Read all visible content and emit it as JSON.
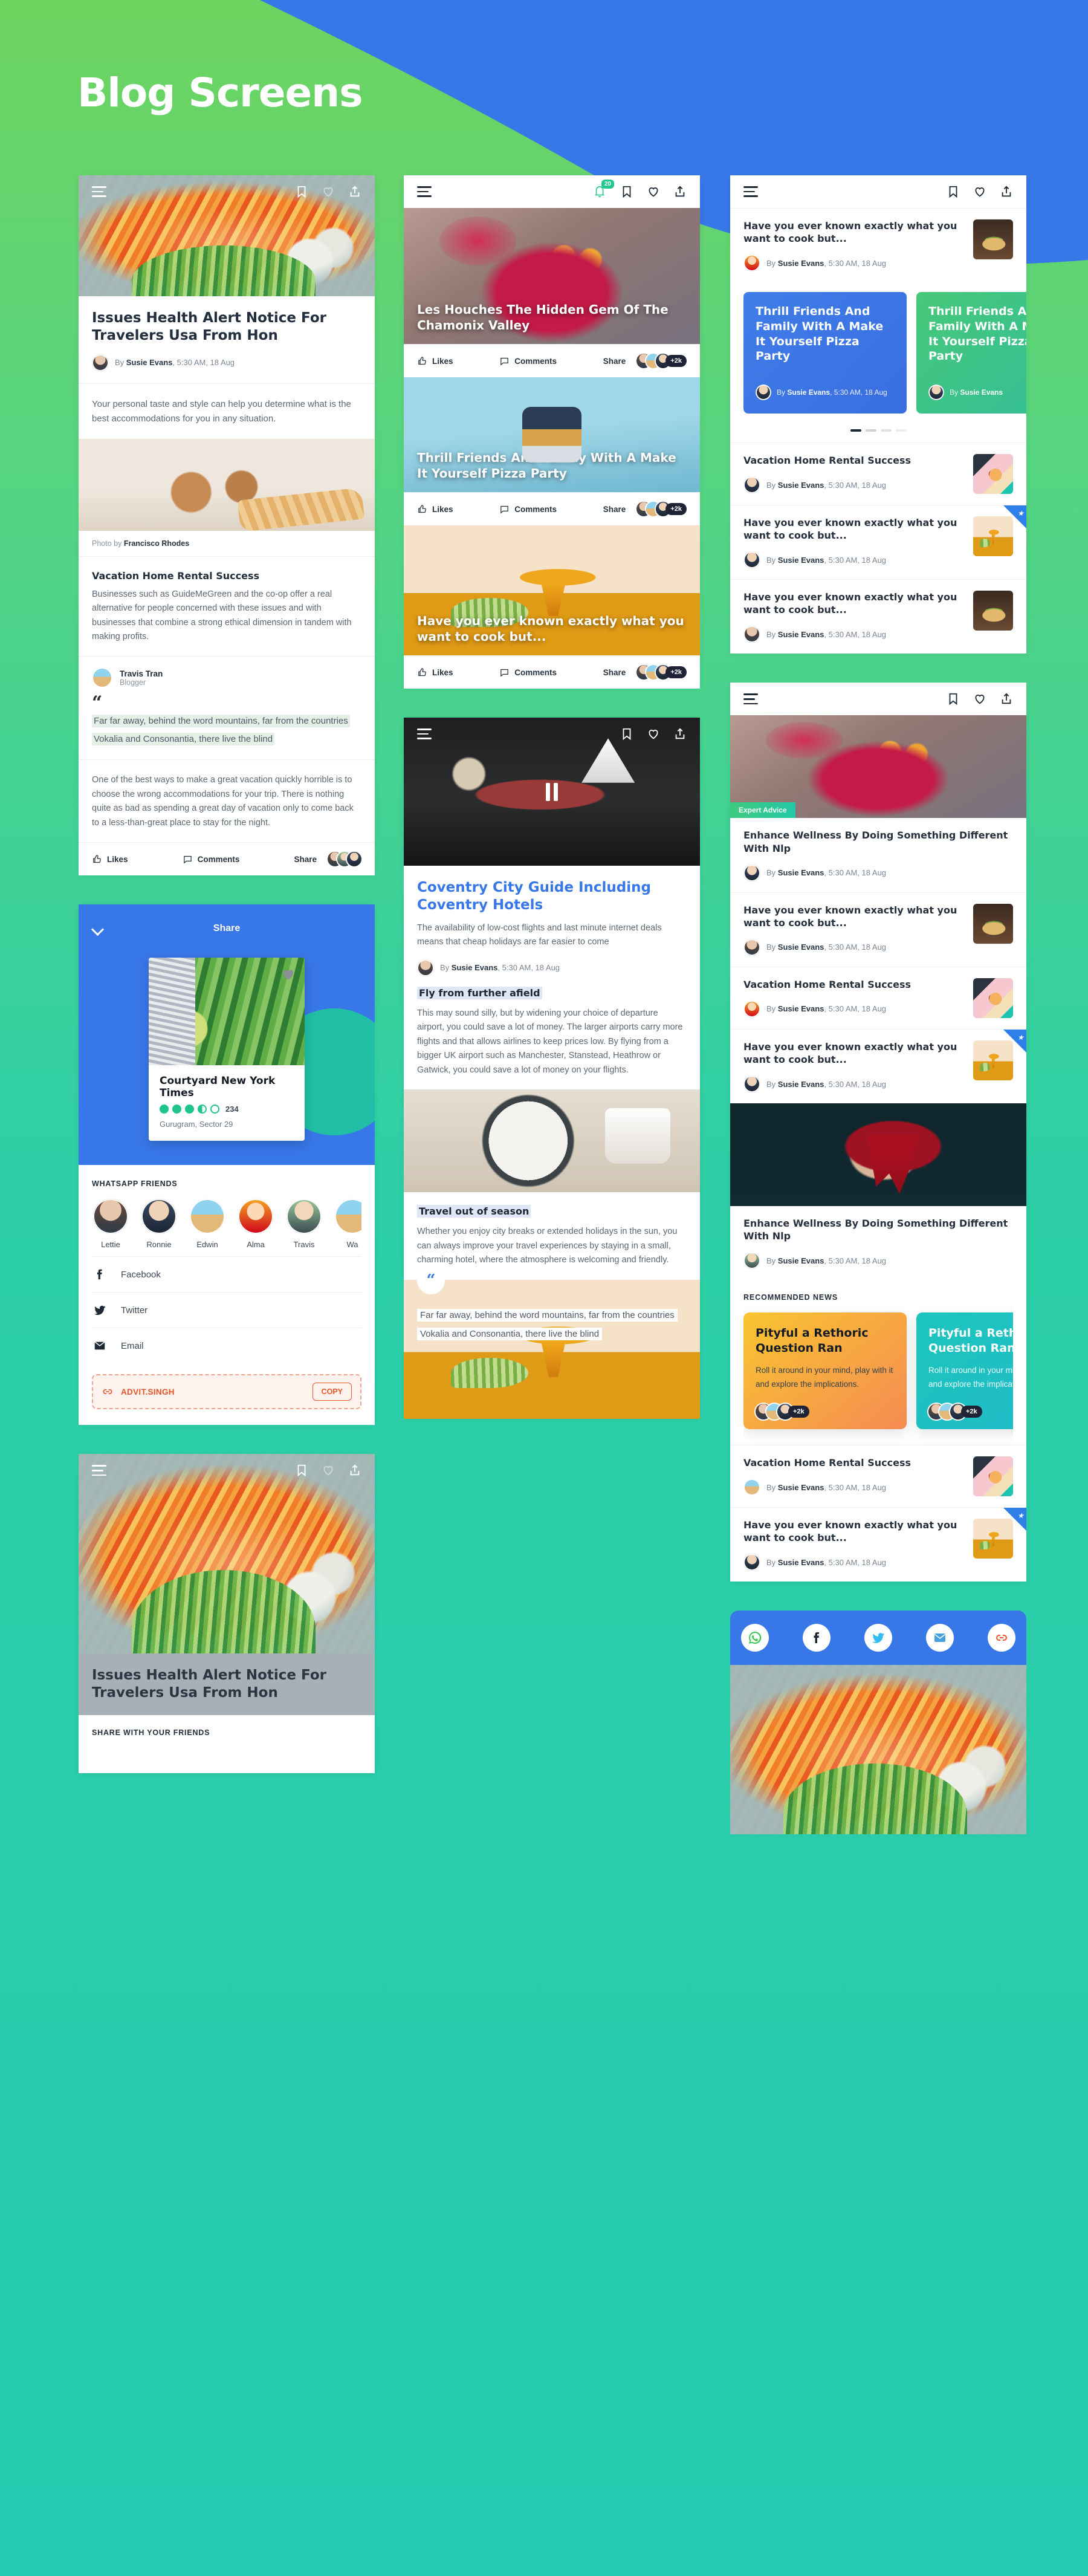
{
  "page": {
    "title": "Blog Screens",
    "bg_green": "#5cd46a",
    "bg_blue": "#3877e8",
    "bg_teal": "#23cbb0"
  },
  "common": {
    "byline_prefix": "By",
    "author": "Susie Evans",
    "timestamp": ", 5:30 AM, 18 Aug",
    "likes": "Likes",
    "comments": "Comments",
    "share": "Share",
    "plus_count": "+2k",
    "notif_count": "20"
  },
  "article_main": {
    "title": "Issues Health Alert Notice For Travelers Usa From Hon",
    "lede": "Your personal taste and style can help you determine what is the best accommodations for you in any situation.",
    "photo_credit_label": "Photo by",
    "photo_credit_name": "Francisco Rhodes",
    "section_heading": "Vacation Home Rental Success",
    "section_body": "Businesses such as GuideMeGreen and the co-op offer a real alternative for people concerned with these issues and with businesses that combine a strong ethical dimension in tandem with making profits.",
    "quote_author": "Travis Tran",
    "quote_role": "Blogger",
    "quote_text": "Far far away, behind the word mountains, far from the countries Vokalia and Consonantia, there live the blind",
    "closing_body": "One of the best ways to make a great vacation quickly horrible is to choose the wrong accommodations for your trip. There is nothing quite as bad as spending a great day of vacation only to come back to a less-than-great place to stay for the night."
  },
  "share_sheet": {
    "title": "Share",
    "place_name": "Courtyard New York Times",
    "rating_value": 3.5,
    "rating_count": "234",
    "address": "Gurugram, Sector 29",
    "whatsapp_label": "WHATSAPP FRIENDS",
    "friends": [
      {
        "name": "Lettie"
      },
      {
        "name": "Ronnie"
      },
      {
        "name": "Edwin"
      },
      {
        "name": "Alma"
      },
      {
        "name": "Travis"
      },
      {
        "name": "Wa"
      }
    ],
    "channels": [
      {
        "label": "Facebook",
        "icon": "facebook-icon"
      },
      {
        "label": "Twitter",
        "icon": "twitter-icon"
      },
      {
        "label": "Email",
        "icon": "email-icon"
      }
    ],
    "copy_id": "ADVIT.SINGH",
    "copy_button": "COPY"
  },
  "bottom_card": {
    "title": "Issues Health Alert Notice For Travelers Usa From Hon",
    "share_label": "SHARE WITH YOUR FRIENDS"
  },
  "feed_col2": {
    "post1_title": "Les Houches The Hidden Gem Of The Chamonix Valley",
    "post2_title": "Thrill Friends And Family With A Make It Yourself Pizza Party",
    "post3_title": "Have you ever known exactly what you want to cook but..."
  },
  "article_coventry": {
    "title": "Coventry City Guide Including Coventry Hotels",
    "lede": "The availability of low-cost flights and last minute internet deals means that cheap holidays are far easier to come",
    "heading1": "Fly from further afield",
    "body1": "This may sound silly, but by widening your choice of departure airport, you could save a lot of money. The larger airports carry more flights and that allows airlines to keep prices low. By flying from a bigger UK airport such as Manchester, Stanstead, Heathrow or Gatwick, you could save a lot of money on your flights.",
    "heading2": "Travel out of season",
    "body2": "Whether you enjoy city breaks or extended holidays in the sun, you can always improve your travel experiences by staying in a small, charming hotel, where the atmosphere is welcoming and friendly.",
    "quote": "Far far away, behind the word mountains, far from the countries Vokalia and Consonantia, there live the blind"
  },
  "feed_col3": {
    "items_top": [
      {
        "title": "Have you ever known exactly what you want to cook but...",
        "thumb": "sandwich",
        "starred": false
      }
    ],
    "promos": [
      {
        "title": "Thrill Friends And Family With A Make It Yourself Pizza Party",
        "color": "blue"
      },
      {
        "title": "Thrill Friends And Family With A Make It Yourself Pizza Party",
        "color": "green"
      }
    ],
    "items_mid": [
      {
        "title": "Vacation Home Rental Success",
        "thumb": "fruitplate",
        "starred": false
      },
      {
        "title": "Have you ever known exactly what you want to cook but...",
        "thumb": "papaya",
        "starred": true
      },
      {
        "title": "Have you ever known exactly what you want to cook but...",
        "thumb": "sandwich",
        "starred": false
      }
    ],
    "card2": {
      "badge": "Expert Advice",
      "title": "Enhance Wellness By Doing Something Different With Nlp",
      "items": [
        {
          "title": "Have you ever known exactly what you want to cook but...",
          "thumb": "sandwich",
          "starred": false
        },
        {
          "title": "Vacation Home Rental Success",
          "thumb": "fruitplate",
          "starred": false
        },
        {
          "title": "Have you ever known exactly what you want to cook but...",
          "thumb": "papaya",
          "starred": true
        }
      ],
      "title2": "Enhance Wellness By Doing Something Different With Nlp",
      "recommended_label": "RECOMMENDED NEWS",
      "recommended": [
        {
          "title": "Pityful a Rethoric Question Ran",
          "body": "Roll it around in your mind, play with it and explore the implications.",
          "color": "orange"
        },
        {
          "title": "Pityful a Rethoric Question Ran",
          "body": "Roll it around in your mind, play with it and explore the implications.",
          "color": "teal"
        }
      ],
      "items_bottom": [
        {
          "title": "Vacation Home Rental Success",
          "thumb": "fruitplate",
          "starred": false
        },
        {
          "title": "Have you ever known exactly what you want to cook but...",
          "thumb": "papaya",
          "starred": true
        }
      ]
    },
    "social_icons": [
      {
        "name": "whatsapp-icon"
      },
      {
        "name": "facebook-icon"
      },
      {
        "name": "twitter-icon"
      },
      {
        "name": "email-icon"
      },
      {
        "name": "link-icon"
      }
    ]
  }
}
